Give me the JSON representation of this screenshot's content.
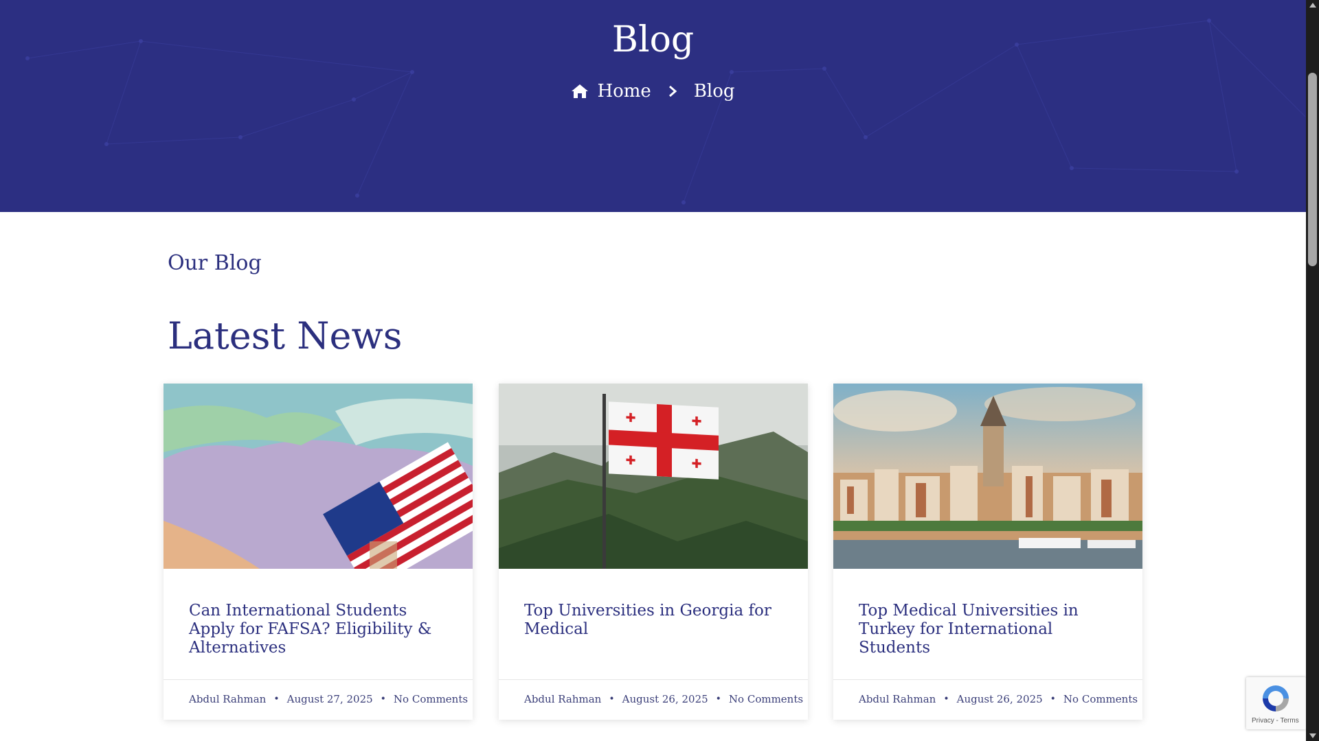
{
  "hero": {
    "title": "Blog",
    "breadcrumb": {
      "home": "Home",
      "current": "Blog"
    }
  },
  "section": {
    "eyebrow": "Our Blog",
    "heading": "Latest News"
  },
  "posts": [
    {
      "title": "Can International Students Apply for FAFSA? Eligibility & Alternatives",
      "image": "usa-map-flag-image",
      "author": "Abdul Rahman",
      "date": "August 27, 2025",
      "comments": "No Comments"
    },
    {
      "title": "Top Universities in Georgia for Medical",
      "image": "georgia-flag-mountains-image",
      "author": "Abdul Rahman",
      "date": "August 26, 2025",
      "comments": "No Comments"
    },
    {
      "title": "Top Medical Universities in Turkey for International Students",
      "image": "istanbul-galata-tower-image",
      "author": "Abdul Rahman",
      "date": "August 26, 2025",
      "comments": "No Comments"
    }
  ],
  "recaptcha": {
    "text": "Privacy - Terms"
  },
  "colors": {
    "hero_bg": "#2c2f82",
    "heading": "#2b2f7e",
    "text": "#3a3e78"
  },
  "icons": {
    "home": "home-icon",
    "separator": "chevron-right-icon",
    "recaptcha": "recaptcha-icon"
  }
}
